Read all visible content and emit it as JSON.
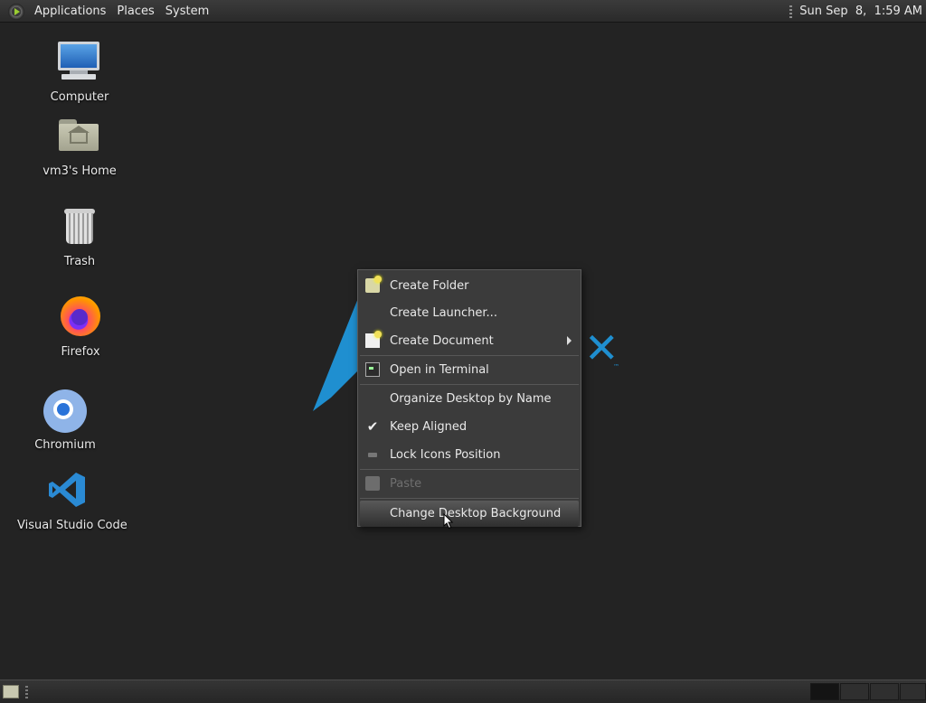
{
  "top_panel": {
    "menu": [
      "Applications",
      "Places",
      "System"
    ],
    "clock": "Sun Sep  8,  1:59 AM"
  },
  "desktop_icons": [
    {
      "label": "Computer",
      "icon": "computer-icon"
    },
    {
      "label": "vm3's Home",
      "icon": "home-folder-icon"
    },
    {
      "label": "Trash",
      "icon": "trash-icon"
    },
    {
      "label": "Firefox",
      "icon": "firefox-icon"
    },
    {
      "label": "Chromium",
      "icon": "chromium-icon"
    },
    {
      "label": "Visual Studio Code",
      "icon": "vscode-icon"
    }
  ],
  "context_menu": {
    "items": [
      {
        "label": "Create Folder",
        "icon": "folder-new-icon"
      },
      {
        "label": "Create Launcher...",
        "icon": ""
      },
      {
        "label": "Create Document",
        "icon": "document-new-icon",
        "submenu": true
      },
      {
        "label": "Open in Terminal",
        "icon": "terminal-icon"
      },
      {
        "label": "Organize Desktop by Name",
        "icon": ""
      },
      {
        "label": "Keep Aligned",
        "icon": "check-icon",
        "checked": true
      },
      {
        "label": "Lock Icons Position",
        "icon": "lock-icon"
      },
      {
        "label": "Paste",
        "icon": "paste-icon",
        "disabled": true
      },
      {
        "label": "Change Desktop Background",
        "icon": "",
        "highlighted": true
      }
    ]
  },
  "colors": {
    "desktop_bg": "#232323",
    "arch_blue": "#1f8fd0"
  }
}
